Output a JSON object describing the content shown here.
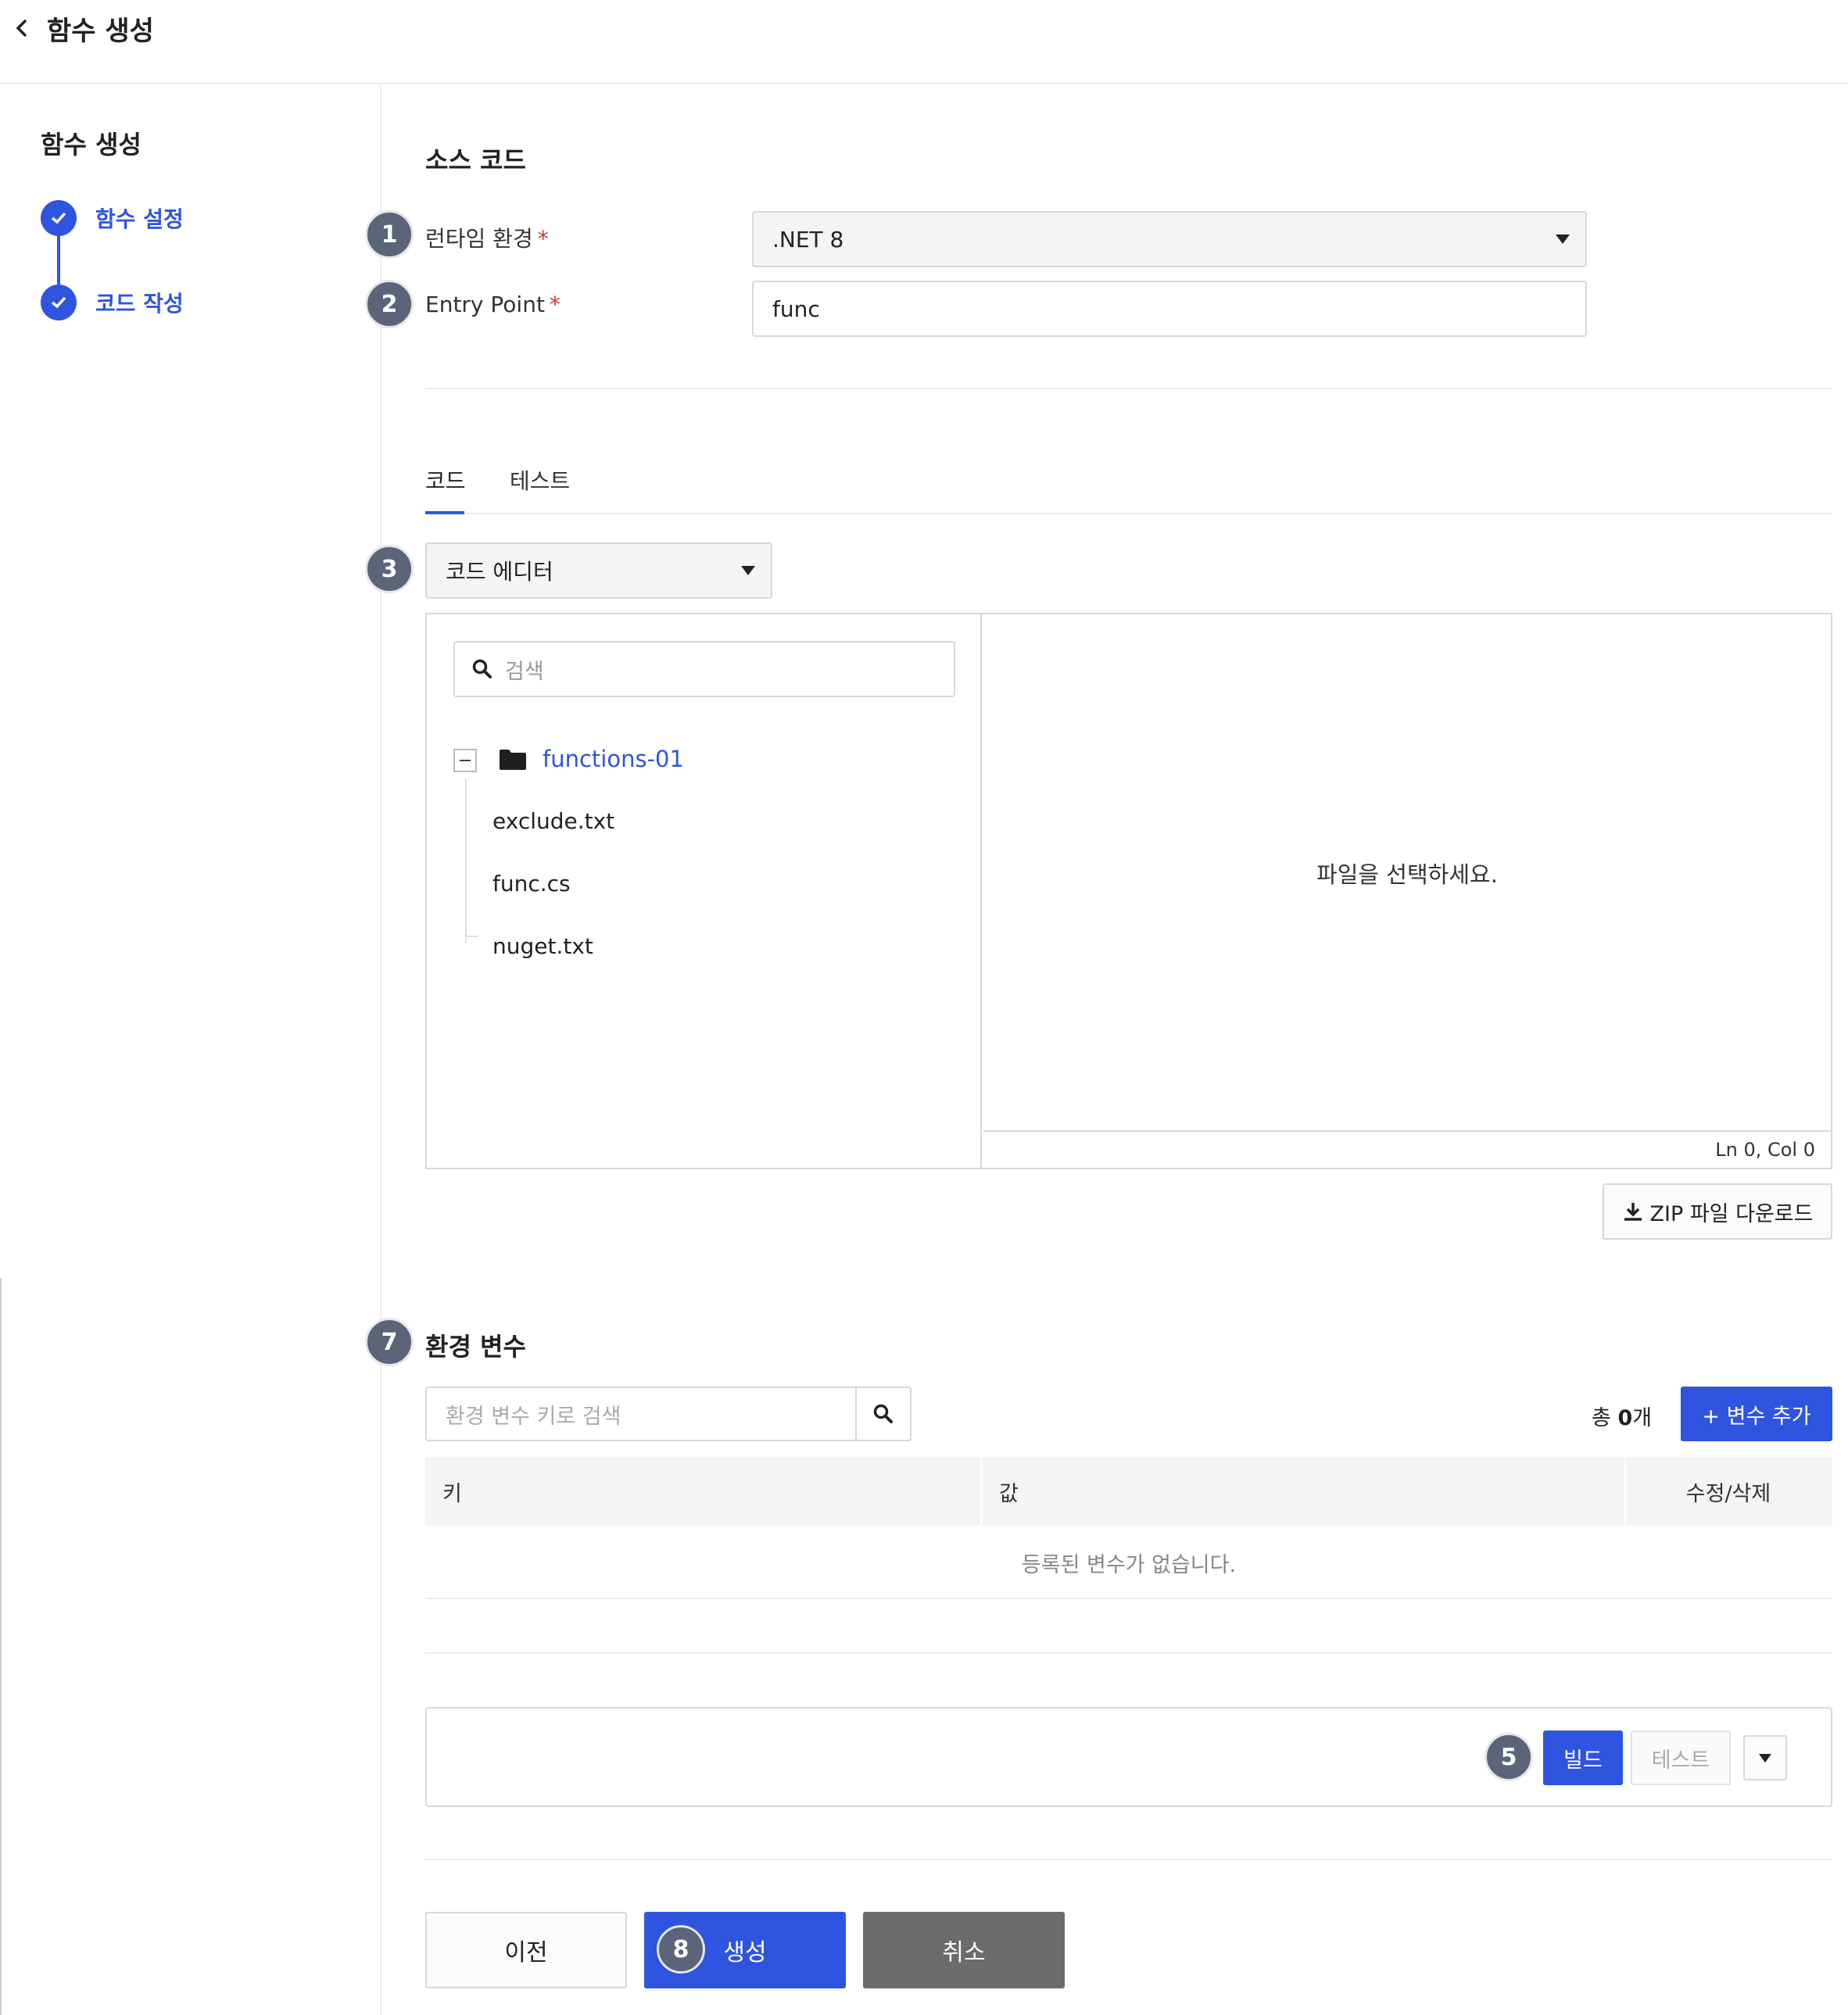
{
  "header": {
    "title": "함수 생성"
  },
  "sidebar": {
    "title": "함수 생성",
    "steps": [
      {
        "label": "함수 설정"
      },
      {
        "label": "코드 작성"
      }
    ]
  },
  "source": {
    "title": "소스 코드",
    "runtime": {
      "label": "런타임 환경",
      "required_mark": "*",
      "value": ".NET 8"
    },
    "entry_point": {
      "label": "Entry Point",
      "required_mark": "*",
      "value": "func"
    }
  },
  "tabs": [
    {
      "label": "코드",
      "active": true
    },
    {
      "label": "테스트",
      "active": false
    }
  ],
  "editor_mode": {
    "value": "코드 에디터"
  },
  "file_tree": {
    "search_placeholder": "검색",
    "folder": "functions-01",
    "files": [
      "exclude.txt",
      "func.cs",
      "nuget.txt"
    ]
  },
  "code_view": {
    "empty_message": "파일을 선택하세요.",
    "cursor_status": "Ln 0, Col 0"
  },
  "zip_download": {
    "label": "ZIP 파일 다운로드"
  },
  "env": {
    "title": "환경 변수",
    "search_placeholder": "환경 변수 키로 검색",
    "count_prefix": "총 ",
    "count_value": "0",
    "count_suffix": "개",
    "add_label": "+ 변수 추가",
    "columns": {
      "key": "키",
      "value": "값",
      "actions": "수정/삭제"
    },
    "empty_message": "등록된 변수가 없습니다."
  },
  "build": {
    "build_label": "빌드",
    "test_label": "테스트"
  },
  "footer": {
    "prev_label": "이전",
    "create_label": "생성",
    "cancel_label": "취소"
  },
  "badges": {
    "runtime": "1",
    "entry": "2",
    "editor": "3",
    "build": "5",
    "env": "7",
    "create": "8"
  },
  "colors": {
    "accent": "#2f54e0",
    "badge": "#5b6478",
    "cancel": "#6b6b6b",
    "required": "#e03131"
  },
  "icons": [
    "chevron-left-icon",
    "check-icon",
    "caret-down-icon",
    "search-icon",
    "folder-icon",
    "collapse-icon",
    "download-icon"
  ]
}
